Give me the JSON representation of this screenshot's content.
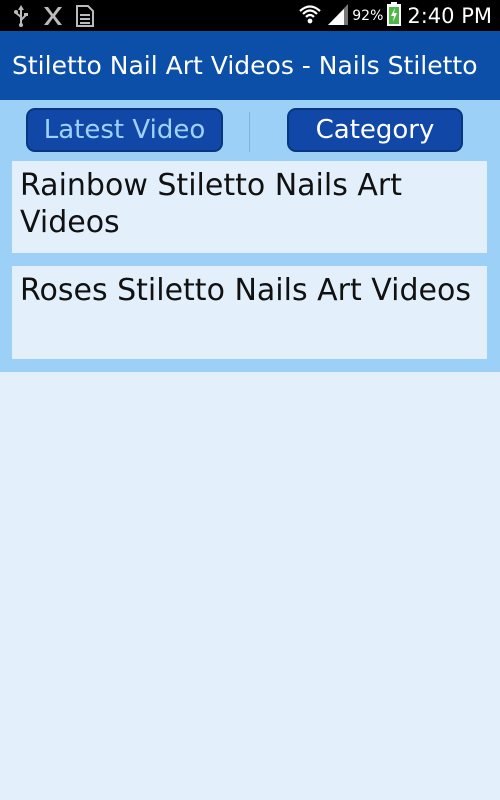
{
  "status_bar": {
    "icons_left": [
      "usb-icon",
      "x-icon",
      "sd-card-icon"
    ],
    "wifi": "wifi-icon",
    "signal": "signal-icon",
    "battery_percent": "92%",
    "battery": "battery-charging-icon",
    "time": "2:40 PM"
  },
  "action_bar": {
    "title": "Stiletto Nail Art Videos - Nails Stiletto"
  },
  "tabs": {
    "latest_label": "Latest Video",
    "category_label": "Category"
  },
  "videos": [
    {
      "title": "Rainbow Stiletto Nails Art Videos"
    },
    {
      "title": "Roses Stiletto Nails Art Videos"
    }
  ],
  "colors": {
    "action_bar": "#0c4fa8",
    "tab_button": "#1148a8",
    "panel": "#9cd0f7",
    "background": "#e3f0fb"
  }
}
